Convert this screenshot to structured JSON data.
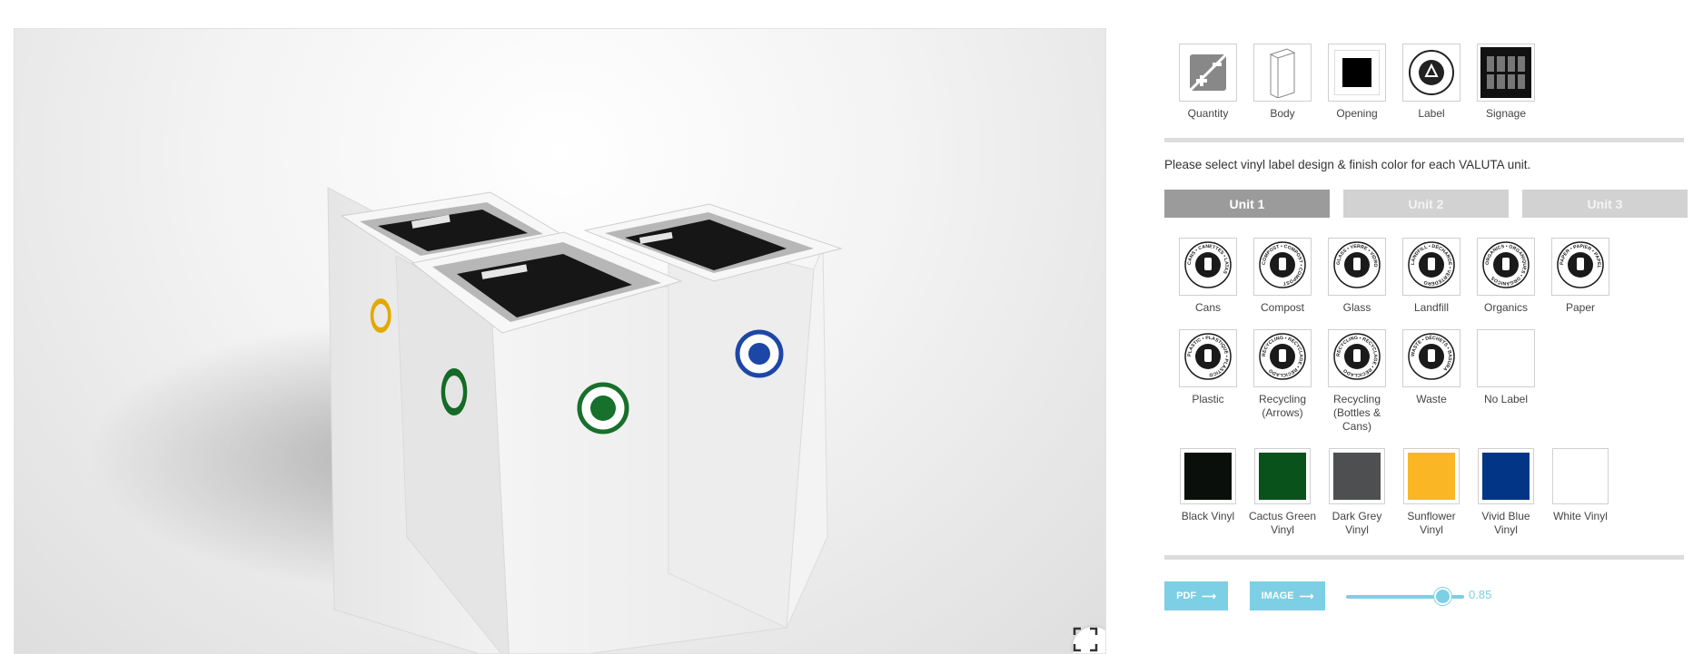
{
  "categories": {
    "items": [
      {
        "label": "Quantity",
        "icon": "quantity-icon"
      },
      {
        "label": "Body",
        "icon": "body-icon"
      },
      {
        "label": "Opening",
        "icon": "opening-icon"
      },
      {
        "label": "Label",
        "icon": "recycling-label-icon"
      },
      {
        "label": "Signage",
        "icon": "signage-icon"
      }
    ]
  },
  "prompt": "Please select vinyl label design & finish color for each VALUTA unit.",
  "units": [
    {
      "label": "Unit 1",
      "state": "active"
    },
    {
      "label": "Unit 2",
      "state": "inactive"
    },
    {
      "label": "Unit 3",
      "state": "inactive"
    }
  ],
  "labels": {
    "items": [
      {
        "label": "Cans",
        "ring": "CANS • CANETTES • LATAS"
      },
      {
        "label": "Compost",
        "ring": "COMPOST • COMPOST • COMPOST"
      },
      {
        "label": "Glass",
        "ring": "GLASS • VERRE • VIDRO"
      },
      {
        "label": "Landfill",
        "ring": "LANDFILL • DÉCHARGE • VERTEDERO"
      },
      {
        "label": "Organics",
        "ring": "ORGANICS • ORGANIQUES • ORGÁNICOS"
      },
      {
        "label": "Paper",
        "ring": "PAPER • PAPIER • PAPEL"
      },
      {
        "label": "Plastic",
        "ring": "PLASTIC • PLASTIQUE • PLÁSTICO"
      },
      {
        "label": "Recycling (Arrows)",
        "ring": "RECYCLING • RECYCLAGE • RECICLADO"
      },
      {
        "label": "Recycling (Bottles & Cans)",
        "ring": "RECYCLING • RECYCLAGE • RECICLADO"
      },
      {
        "label": "Waste",
        "ring": "WASTE • DÉCHETS • BASURA"
      },
      {
        "label": "No Label",
        "ring": ""
      }
    ]
  },
  "colors": {
    "items": [
      {
        "label": "Black Vinyl",
        "hex": "#0b0f0c"
      },
      {
        "label": "Cactus Green Vinyl",
        "hex": "#0a521b"
      },
      {
        "label": "Dark Grey Vinyl",
        "hex": "#4d4f50"
      },
      {
        "label": "Sunflower Vinyl",
        "hex": "#fbb626"
      },
      {
        "label": "Vivid Blue Vinyl",
        "hex": "#033587"
      },
      {
        "label": "White Vinyl",
        "hex": "#ffffff"
      }
    ]
  },
  "export": {
    "pdf_label": "PDF",
    "image_label": "IMAGE"
  },
  "zoom": {
    "value": "0.85"
  },
  "theme": {
    "accent": "#7ccfe4",
    "active_tab": "#9b9b9b",
    "inactive_tab": "#d2d2d2"
  }
}
